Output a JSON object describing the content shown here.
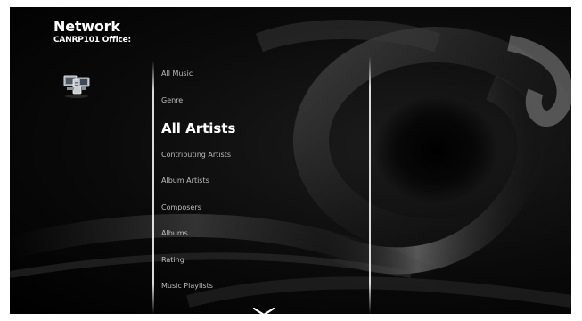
{
  "header": {
    "title": "Network",
    "subtitle": "CANRP101 Office:"
  },
  "menu": {
    "items": [
      {
        "label": "All Music",
        "selected": false
      },
      {
        "label": "Genre",
        "selected": false
      },
      {
        "label": "All Artists",
        "selected": true
      },
      {
        "label": "Contributing Artists",
        "selected": false
      },
      {
        "label": "Album Artists",
        "selected": false
      },
      {
        "label": "Composers",
        "selected": false
      },
      {
        "label": "Albums",
        "selected": false
      },
      {
        "label": "Rating",
        "selected": false
      },
      {
        "label": "Music Playlists",
        "selected": false
      }
    ]
  },
  "icons": {
    "network": "network-computers-icon",
    "scroll_down": "chevron-down-icon"
  },
  "colors": {
    "background": "#000000",
    "text_selected": "#ffffff",
    "text_normal": "#bdbdbd"
  }
}
